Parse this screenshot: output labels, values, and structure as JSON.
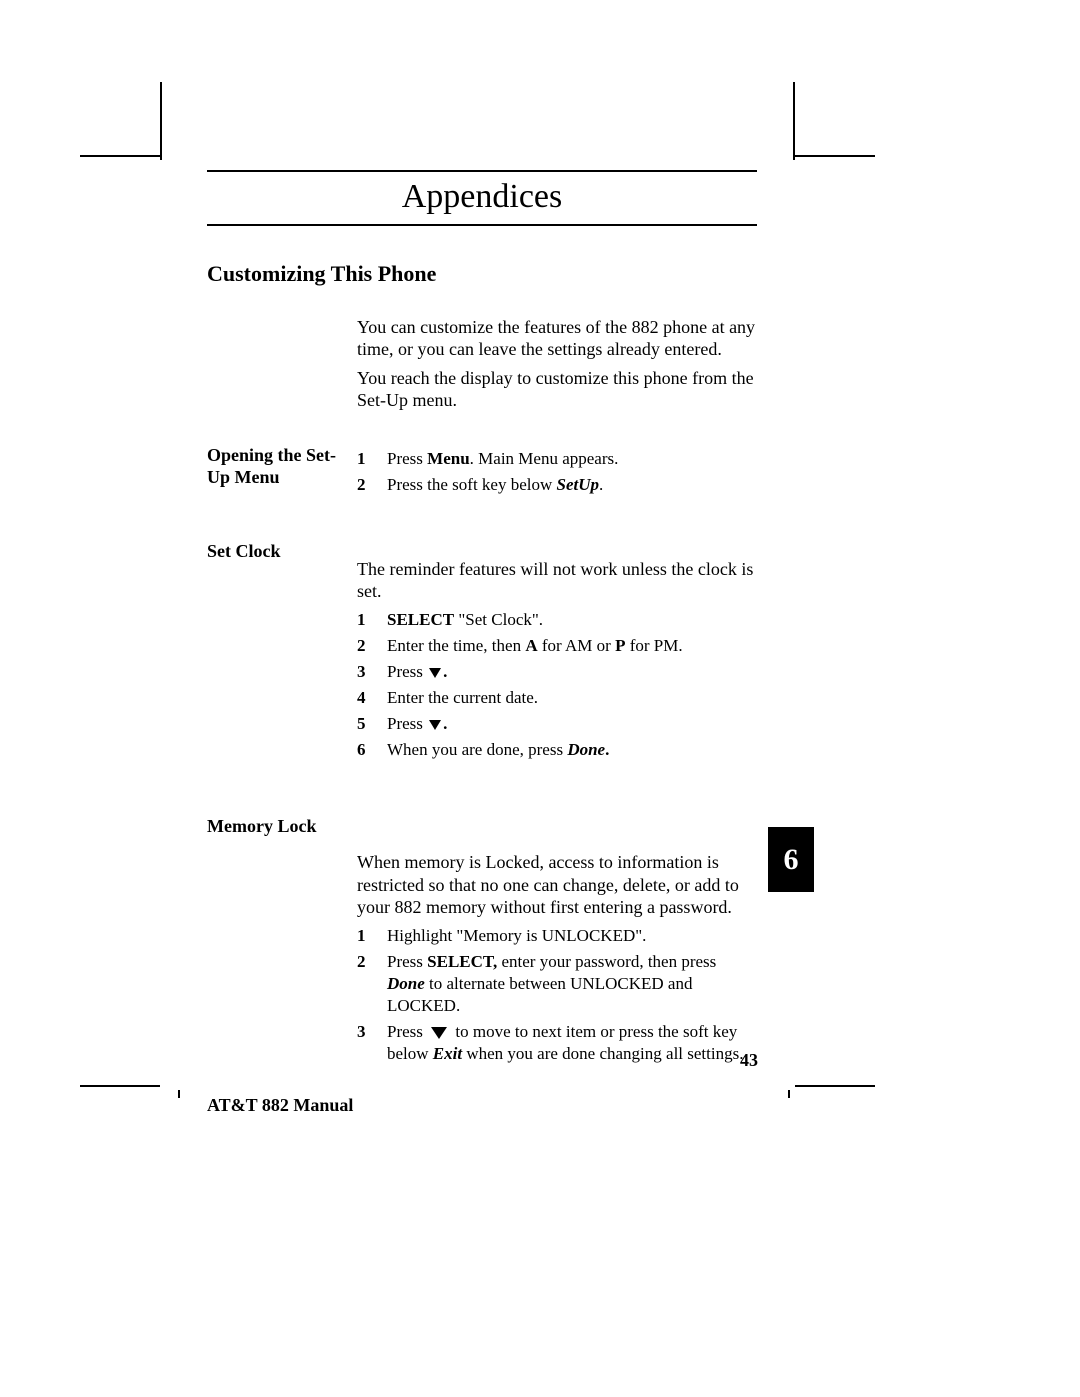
{
  "chapter_title": "Appendices",
  "section_title": "Customizing This Phone",
  "intro_para1": "You can customize the features of the 882 phone at any time, or you can leave the settings already entered.",
  "intro_para2": "You reach the display to customize this phone from the Set-Up menu.",
  "opening": {
    "heading": "Opening the Set-Up Menu",
    "step1_num": "1",
    "step1_pre": "Press ",
    "step1_bold": "Menu",
    "step1_post": ".  Main Menu appears.",
    "step2_num": "2",
    "step2_pre": "Press the soft key below ",
    "step2_bi": "SetUp",
    "step2_post": "."
  },
  "setclock": {
    "heading": "Set Clock",
    "intro": "The reminder features will not work unless the clock is set.",
    "s1_num": "1",
    "s1_b": "SELECT",
    "s1_post": " \"Set Clock\".",
    "s2_num": "2",
    "s2_pre": "Enter the time, then ",
    "s2_b1": "A",
    "s2_mid": " for AM or ",
    "s2_b2": "P",
    "s2_post": " for PM.",
    "s3_num": "3",
    "s3_pre": "Press ",
    "s3_post": ".",
    "s4_num": "4",
    "s4_txt": "Enter the current date.",
    "s5_num": "5",
    "s5_pre": "Press ",
    "s5_post": ".",
    "s6_num": "6",
    "s6_pre": "When you are done, press ",
    "s6_bi": "Done",
    "s6_post": "."
  },
  "memlock": {
    "heading": "Memory Lock",
    "intro": "When memory is Locked, access to information is restricted so that no one can change, delete, or add to your 882 memory without first entering a password.",
    "s1_num": "1",
    "s1_txt": "Highlight \"Memory is UNLOCKED\".",
    "s2_num": "2",
    "s2_pre": "Press ",
    "s2_b": "SELECT,",
    "s2_mid": " enter your password, then press ",
    "s2_bi": "Done",
    "s2_post": " to alternate between UNLOCKED and LOCKED.",
    "s3_num": "3",
    "s3_pre": "Press ",
    "s3_mid": " to move to next item or press the soft key below ",
    "s3_bi": "Exit",
    "s3_post": " when you are done changing all settings."
  },
  "thumb_tab": "6",
  "page_number": "43",
  "footer": "AT&T 882 Manual"
}
